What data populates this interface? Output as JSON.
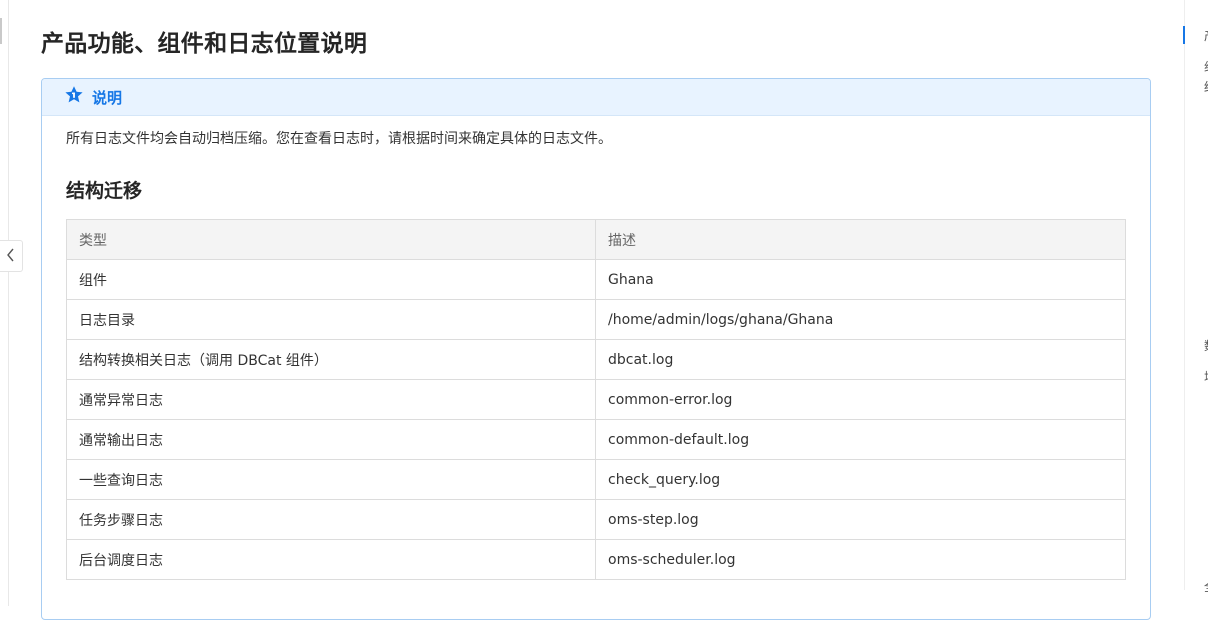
{
  "page": {
    "title": "产品功能、组件和日志位置说明"
  },
  "notice": {
    "title": "说明",
    "icon": "star-info-icon",
    "text": "所有日志文件均会自动归档压缩。您在查看日志时，请根据时间来确定具体的日志文件。"
  },
  "section": {
    "title": "结构迁移"
  },
  "table": {
    "headers": [
      "类型",
      "描述"
    ],
    "rows": [
      [
        "组件",
        "Ghana"
      ],
      [
        "日志目录",
        "/home/admin/logs/ghana/Ghana"
      ],
      [
        "结构转换相关日志（调用 DBCat 组件）",
        "dbcat.log"
      ],
      [
        "通常异常日志",
        "common-error.log"
      ],
      [
        "通常输出日志",
        "common-default.log"
      ],
      [
        "一些查询日志",
        "check_query.log"
      ],
      [
        "任务步骤日志",
        "oms-step.log"
      ],
      [
        "后台调度日志",
        "oms-scheduler.log"
      ]
    ]
  },
  "toc": {
    "items": [
      "产",
      "组",
      "结",
      "数",
      "增",
      "全"
    ]
  },
  "icons": {
    "collapse": "chevron-left-icon"
  },
  "colors": {
    "accent": "#1677e6",
    "notice_bg": "#e8f3ff",
    "notice_border": "#a8cdf2",
    "table_header_bg": "#f4f4f4"
  }
}
